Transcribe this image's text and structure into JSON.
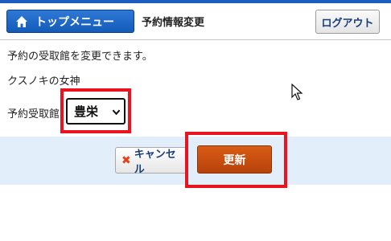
{
  "header": {
    "home_label": "トップメニュー",
    "page_title": "予約情報変更",
    "logout_label": "ログアウト"
  },
  "main": {
    "description": "予約の受取館を変更できます。",
    "book_title": "クスノキの女神",
    "branch_label": "予約受取館",
    "branch_selected": "豊栄"
  },
  "actions": {
    "cancel_label": "キャンセル",
    "update_label": "更新"
  },
  "colors": {
    "header_strip": "#1d5dbf",
    "home_button": "#145bb8",
    "update_button": "#c9500f",
    "highlight": "#e8141f",
    "action_bar": "#e3eefb"
  }
}
